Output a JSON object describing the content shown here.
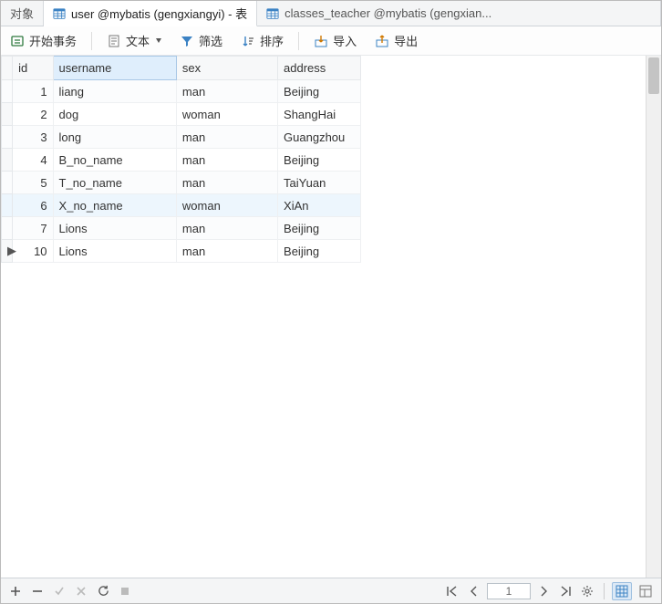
{
  "tabs": {
    "objects": "对象",
    "user_table": "user @mybatis (gengxiangyi) - 表",
    "classes_table": "classes_teacher @mybatis (gengxian..."
  },
  "toolbar": {
    "begin_tx": "开始事务",
    "text": "文本",
    "filter": "筛选",
    "sort": "排序",
    "import": "导入",
    "export": "导出"
  },
  "grid": {
    "headers": {
      "id": "id",
      "username": "username",
      "sex": "sex",
      "address": "address"
    },
    "rows": [
      {
        "id": "1",
        "username": "liang",
        "sex": "man",
        "address": "Beijing"
      },
      {
        "id": "2",
        "username": "dog",
        "sex": "woman",
        "address": "ShangHai"
      },
      {
        "id": "3",
        "username": "long",
        "sex": "man",
        "address": "Guangzhou"
      },
      {
        "id": "4",
        "username": "B_no_name",
        "sex": "man",
        "address": "Beijing"
      },
      {
        "id": "5",
        "username": "T_no_name",
        "sex": "man",
        "address": "TaiYuan"
      },
      {
        "id": "6",
        "username": "X_no_name",
        "sex": "woman",
        "address": "XiAn"
      },
      {
        "id": "7",
        "username": "Lions",
        "sex": "man",
        "address": "Beijing"
      },
      {
        "id": "10",
        "username": "Lions",
        "sex": "man",
        "address": "Beijing"
      }
    ],
    "current_row_marker": "▶",
    "current_row_index": 7
  },
  "footer": {
    "page": "1"
  }
}
